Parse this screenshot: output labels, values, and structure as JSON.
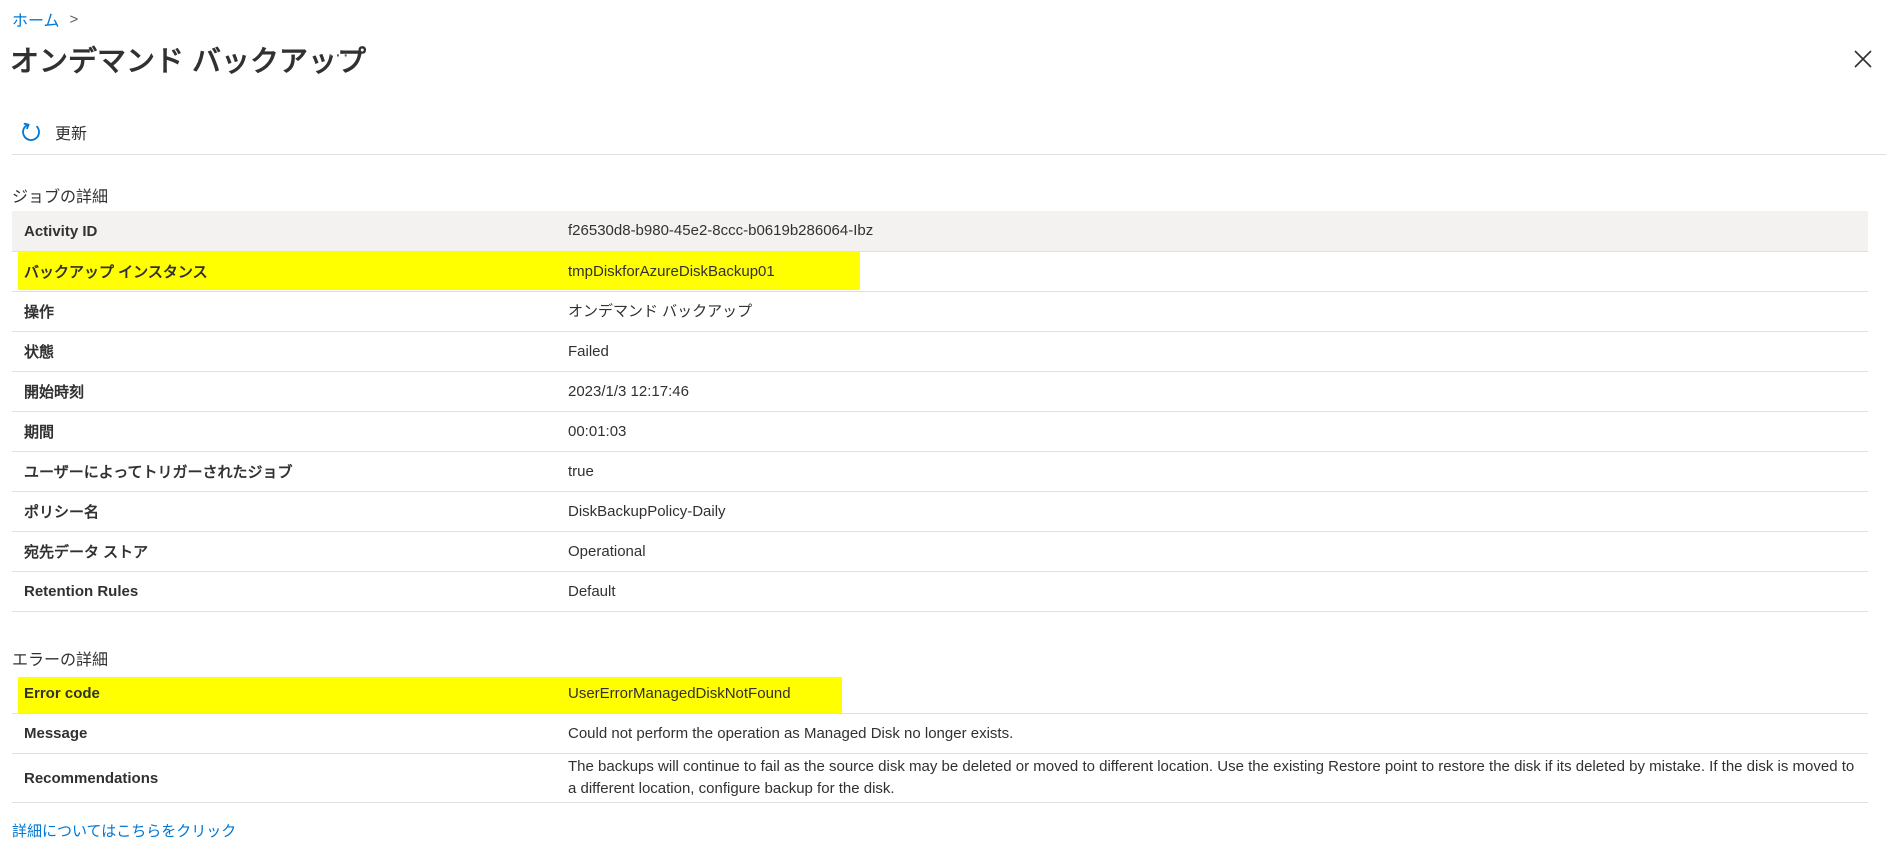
{
  "breadcrumb": {
    "home": "ホーム",
    "separator": ">"
  },
  "page_title": "オンデマンド バックアップ",
  "more_label": "···",
  "toolbar": {
    "refresh_label": "更新"
  },
  "job_details": {
    "heading": "ジョブの詳細",
    "rows": [
      {
        "key": "Activity ID",
        "value": "f26530d8-b980-45e2-8ccc-b0619b286064-Ibz"
      },
      {
        "key": "バックアップ インスタンス",
        "value": "tmpDiskforAzureDiskBackup01"
      },
      {
        "key": "操作",
        "value": "オンデマンド バックアップ"
      },
      {
        "key": "状態",
        "value": "Failed"
      },
      {
        "key": "開始時刻",
        "value": "2023/1/3 12:17:46"
      },
      {
        "key": "期間",
        "value": "00:01:03"
      },
      {
        "key": "ユーザーによってトリガーされたジョブ",
        "value": "true"
      },
      {
        "key": "ポリシー名",
        "value": "DiskBackupPolicy-Daily"
      },
      {
        "key": "宛先データ ストア",
        "value": "Operational"
      },
      {
        "key": "Retention Rules",
        "value": "Default"
      }
    ]
  },
  "error_details": {
    "heading": "エラーの詳細",
    "rows": [
      {
        "key": "Error code",
        "value": "UserErrorManagedDiskNotFound"
      },
      {
        "key": "Message",
        "value": "Could not perform the operation as Managed Disk no longer exists."
      },
      {
        "key": "Recommendations",
        "value": "The backups will continue to fail as the source disk may be deleted or moved to different location. Use the existing Restore point to restore the disk if its deleted by mistake. If the disk is moved to a different location, configure backup for the disk."
      }
    ]
  },
  "learn_more_link": "詳細についてはこちらをクリック",
  "colors": {
    "link": "#0078d4",
    "highlight": "#ffff00",
    "header_row": "#f3f2f1",
    "border": "#e1dfdd"
  }
}
